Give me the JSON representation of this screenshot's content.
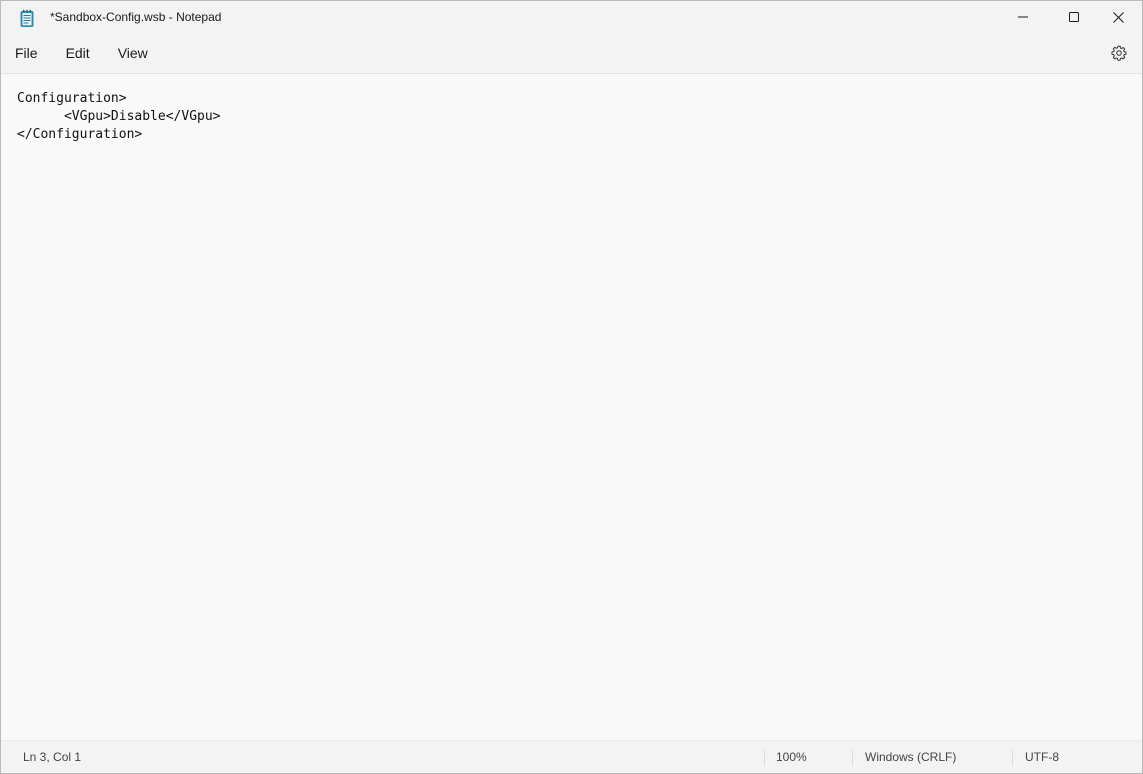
{
  "window": {
    "title": "*Sandbox-Config.wsb - Notepad"
  },
  "titlebar": {
    "icons": [
      "notepad-icon",
      "minimize-icon",
      "maximize-icon",
      "close-icon"
    ]
  },
  "menu": {
    "items": [
      {
        "label": "File"
      },
      {
        "label": "Edit"
      },
      {
        "label": "View"
      }
    ],
    "settings_icon": "gear-icon"
  },
  "editor": {
    "content": "Configuration>\n\t<VGpu>Disable</VGpu>\n</Configuration>"
  },
  "status": {
    "position": "Ln 3, Col 1",
    "zoom": "100%",
    "line_ending": "Windows (CRLF)",
    "encoding": "UTF-8"
  }
}
